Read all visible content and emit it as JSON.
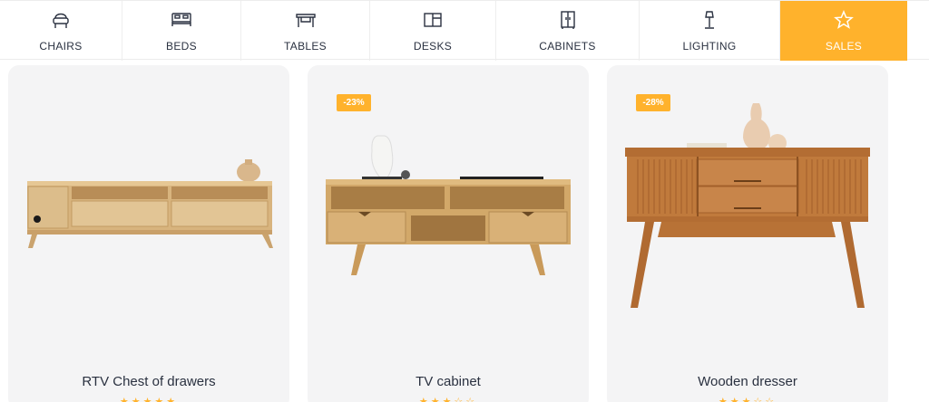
{
  "nav": {
    "items": [
      {
        "label": "CHAIRS",
        "icon": "chair-icon"
      },
      {
        "label": "BEDS",
        "icon": "bed-icon"
      },
      {
        "label": "TABLES",
        "icon": "table-icon"
      },
      {
        "label": "DESKS",
        "icon": "desk-icon"
      },
      {
        "label": "CABINETS",
        "icon": "cabinet-icon"
      },
      {
        "label": "LIGHTING",
        "icon": "lamp-icon"
      },
      {
        "label": "SALES",
        "icon": "star-icon",
        "active": true
      }
    ]
  },
  "products": [
    {
      "title": "RTV Chest of drawers",
      "badge": "",
      "stars": "★★★★★"
    },
    {
      "title": "TV cabinet",
      "badge": "-23%",
      "stars": "★★★☆☆"
    },
    {
      "title": "Wooden dresser",
      "badge": "-28%",
      "stars": "★★★☆☆"
    }
  ],
  "colors": {
    "accent": "#ffb22c",
    "card_bg": "#f4f4f5",
    "text": "#2a3140"
  }
}
